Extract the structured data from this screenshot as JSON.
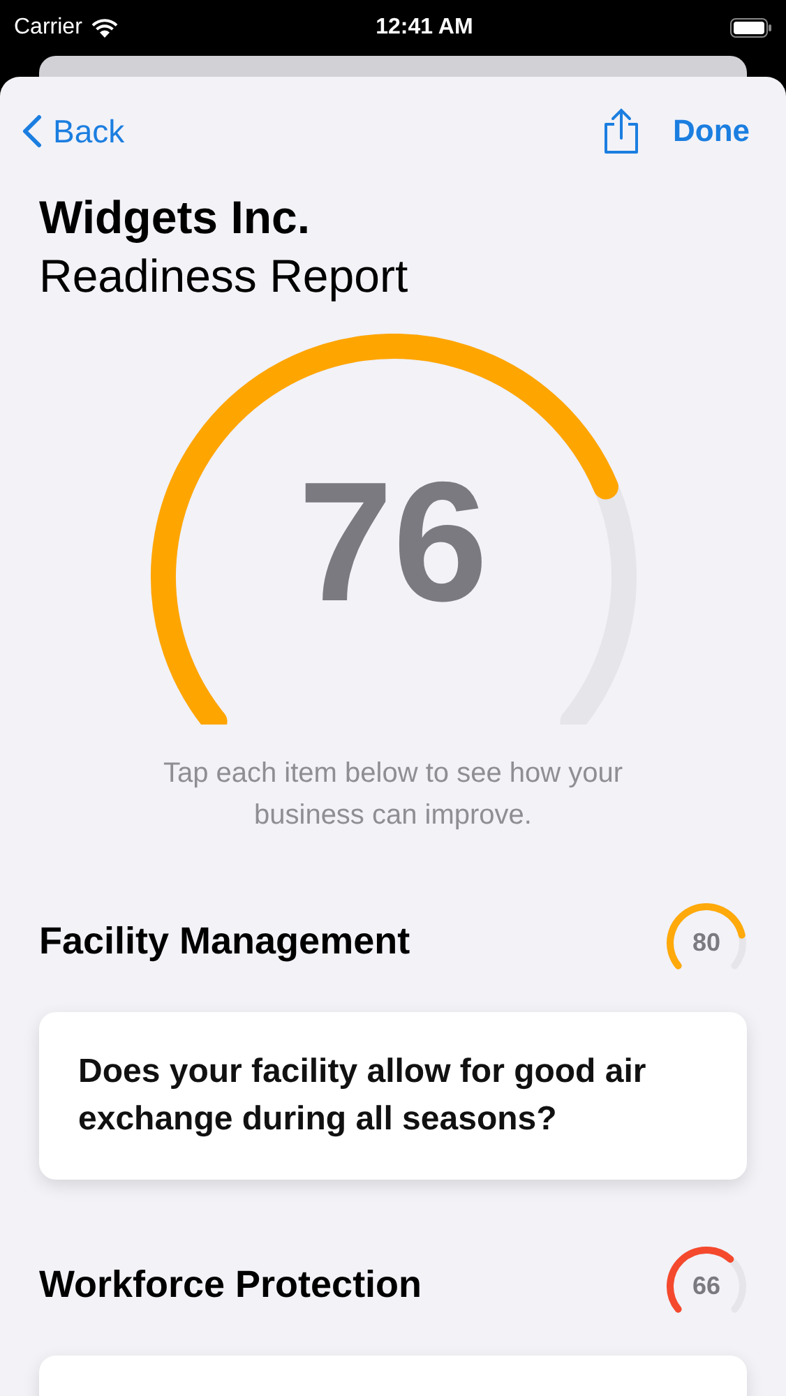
{
  "status_bar": {
    "carrier": "Carrier",
    "time": "12:41 AM"
  },
  "nav": {
    "back": "Back",
    "done": "Done"
  },
  "title": "Widgets Inc.",
  "subtitle": "Readiness Report",
  "score": {
    "value": "76",
    "color": "#ffa500"
  },
  "caption": "Tap each item below to see how your business can improve.",
  "sections": [
    {
      "title": "Facility Management",
      "score": "80",
      "color": "#ffa90a",
      "question": "Does your facility allow for good air exchange during all seasons?"
    },
    {
      "title": "Workforce Protection",
      "score": "66",
      "color": "#f5492d"
    }
  ]
}
